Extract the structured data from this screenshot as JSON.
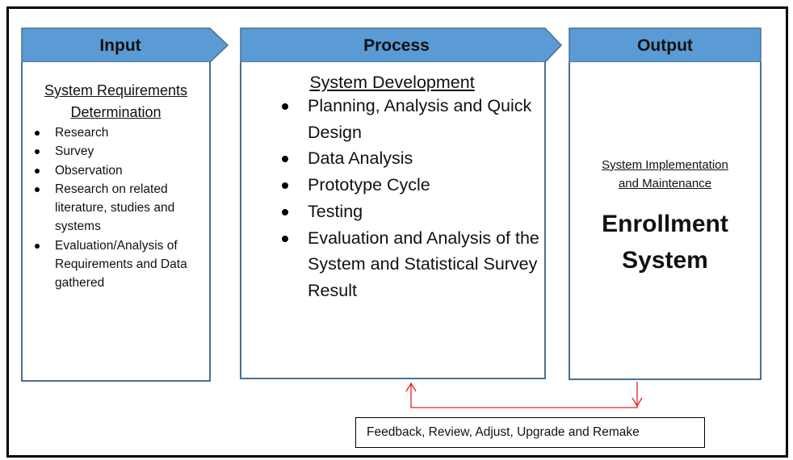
{
  "colors": {
    "header_fill": "#5b9bd5",
    "border": "#4a6f8f",
    "feedback_arrow": "#e02020"
  },
  "input": {
    "title": "Input",
    "subtitle_line1": "System Requirements",
    "subtitle_line2": "Determination",
    "items": [
      "Research",
      "Survey",
      "Observation",
      "Research on related literature, studies and systems",
      "Evaluation/Analysis of Requirements and Data gathered"
    ]
  },
  "process": {
    "title": "Process",
    "subtitle": "System Development",
    "items": [
      "Planning, Analysis and Quick Design",
      "Data Analysis",
      "Prototype Cycle",
      "Testing",
      "Evaluation and Analysis of the System and Statistical Survey Result"
    ]
  },
  "output": {
    "title": "Output",
    "subtitle_line1": "System Implementation",
    "subtitle_line2": "and Maintenance",
    "result_line1": "Enrollment",
    "result_line2": "System"
  },
  "feedback": {
    "label": "Feedback, Review, Adjust, Upgrade and Remake"
  }
}
